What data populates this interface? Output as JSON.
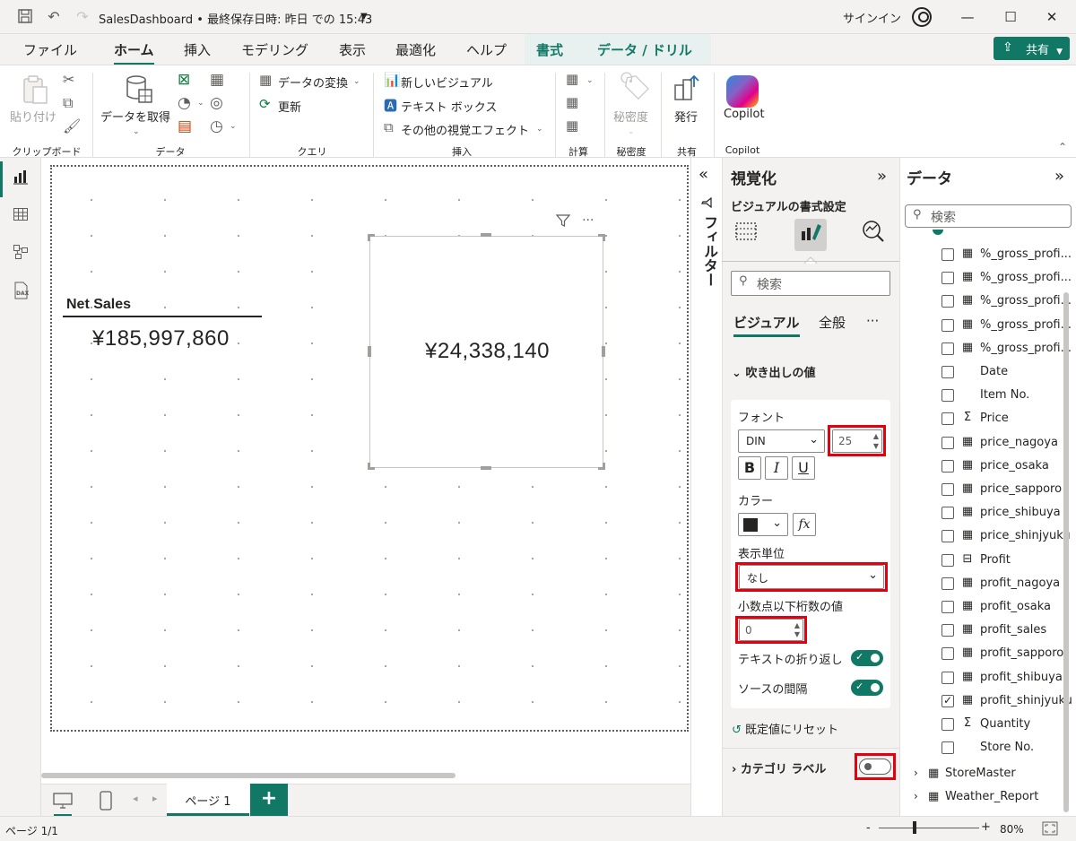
{
  "titlebar": {
    "title": "SalesDashboard • 最終保存日時: 昨日 での 15:43",
    "dropdown_icon": "chevron-down",
    "signin": "サインイン",
    "icons": [
      "save-icon",
      "undo-icon",
      "redo-icon"
    ]
  },
  "menu": {
    "tabs": [
      {
        "label": "ファイル"
      },
      {
        "label": "ホーム"
      },
      {
        "label": "挿入"
      },
      {
        "label": "モデリング"
      },
      {
        "label": "表示"
      },
      {
        "label": "最適化"
      },
      {
        "label": "ヘルプ"
      },
      {
        "label": "書式"
      },
      {
        "label": "データ / ドリル"
      }
    ],
    "share": "共有"
  },
  "ribbon": {
    "paste": "貼り付け",
    "clipboard": "クリップボード",
    "get_data": "データを取得",
    "data_group": "データ",
    "transform": "データの変換",
    "refresh": "更新",
    "query_group": "クエリ",
    "new_visual": "新しいビジュアル",
    "text_box": "テキスト ボックス",
    "more_visuals": "その他の視覚エフェクト",
    "insert_group": "挿入",
    "calc_group": "計算",
    "sensitivity": "秘密度",
    "sensitivity_group": "秘密度",
    "publish": "発行",
    "share_group": "共有",
    "copilot": "Copilot",
    "copilot_group": "Copilot"
  },
  "canvas": {
    "net_sales_title": "Net Sales",
    "net_sales_value": "¥185,997,860",
    "card_value": "¥24,338,140"
  },
  "filters": {
    "label": "フィルター"
  },
  "viz": {
    "title": "視覚化",
    "subtitle": "ビジュアルの書式設定",
    "search_placeholder": "検索",
    "tab_visual": "ビジュアル",
    "tab_general": "全般",
    "more": "···",
    "section_callout": "吹き出しの値",
    "font_label": "フォント",
    "font_family": "DIN",
    "font_size": "25",
    "bold": "B",
    "italic": "I",
    "underline": "U",
    "color_label": "カラー",
    "color_swatch": "#252423",
    "fx": "fx",
    "display_units_label": "表示単位",
    "display_units_value": "なし",
    "decimals_label": "小数点以下桁数の値",
    "decimals_value": "0",
    "text_wrap_label": "テキストの折り返し",
    "text_wrap_on": true,
    "source_spacing_label": "ソースの間隔",
    "source_spacing_on": true,
    "reset": "既定値にリセット",
    "section_category": "カテゴリ ラベル",
    "category_on": false
  },
  "datapane": {
    "title": "データ",
    "search_placeholder": "検索",
    "fields": [
      {
        "name": "%_gross_profi...",
        "type": "calc",
        "checked": false
      },
      {
        "name": "%_gross_profi...",
        "type": "calc",
        "checked": false
      },
      {
        "name": "%_gross_profi...",
        "type": "calc",
        "checked": false
      },
      {
        "name": "%_gross_profi...",
        "type": "calc",
        "checked": false
      },
      {
        "name": "%_gross_profi...",
        "type": "calc",
        "checked": false
      },
      {
        "name": "Date",
        "type": "none",
        "checked": false
      },
      {
        "name": "Item No.",
        "type": "none",
        "checked": false
      },
      {
        "name": "Price",
        "type": "sum",
        "checked": false
      },
      {
        "name": "price_nagoya",
        "type": "calc",
        "checked": false
      },
      {
        "name": "price_osaka",
        "type": "calc",
        "checked": false
      },
      {
        "name": "price_sapporo",
        "type": "calc",
        "checked": false
      },
      {
        "name": "price_shibuya",
        "type": "calc",
        "checked": false
      },
      {
        "name": "price_shinjyuku",
        "type": "calc",
        "checked": false
      },
      {
        "name": "Profit",
        "type": "measure",
        "checked": false
      },
      {
        "name": "profit_nagoya",
        "type": "calc",
        "checked": false
      },
      {
        "name": "profit_osaka",
        "type": "calc",
        "checked": false
      },
      {
        "name": "profit_sales",
        "type": "calc",
        "checked": false
      },
      {
        "name": "profit_sapporo",
        "type": "calc",
        "checked": false
      },
      {
        "name": "profit_shibuya",
        "type": "calc",
        "checked": false
      },
      {
        "name": "profit_shinjyuku",
        "type": "calc",
        "checked": true
      },
      {
        "name": "Quantity",
        "type": "sum",
        "checked": false
      },
      {
        "name": "Store No.",
        "type": "none",
        "checked": false
      }
    ],
    "tables": [
      {
        "name": "StoreMaster"
      },
      {
        "name": "Weather_Report"
      }
    ]
  },
  "pages": {
    "current": "ページ 1",
    "add": "+"
  },
  "status": {
    "page_info": "ページ 1/1",
    "zoom": "80%"
  }
}
